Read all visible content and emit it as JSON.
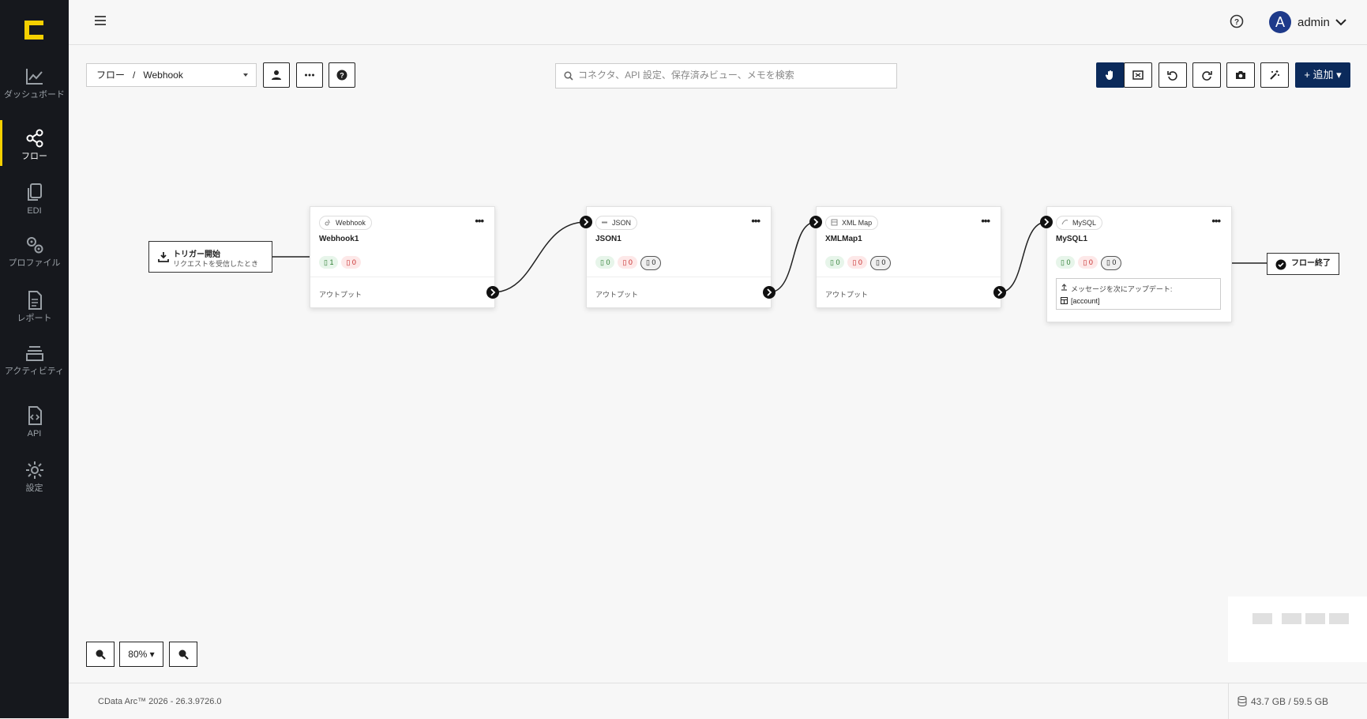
{
  "sidebar": {
    "items": [
      {
        "label": "ダッシュボード",
        "icon": "chart-line-icon"
      },
      {
        "label": "フロー",
        "icon": "share-nodes-icon",
        "active": true
      },
      {
        "label": "EDI",
        "icon": "documents-icon"
      },
      {
        "label": "プロファイル",
        "icon": "gears-icon"
      },
      {
        "label": "レポート",
        "icon": "report-icon"
      },
      {
        "label": "アクティビティ",
        "icon": "layers-icon"
      },
      {
        "label": "API",
        "icon": "api-file-icon"
      },
      {
        "label": "設定",
        "icon": "gear-icon"
      }
    ]
  },
  "header": {
    "avatar_initial": "A",
    "user": "admin"
  },
  "breadcrumb": {
    "root": "フロー",
    "separator": "/",
    "current": "Webhook"
  },
  "search": {
    "placeholder": "コネクタ、API 設定、保存済みビュー、メモを検索"
  },
  "toolbar": {
    "add_label": "+ 追加",
    "colors": {
      "primary": "#0b2a5b",
      "accent": "#f5d000"
    }
  },
  "trigger": {
    "title": "トリガー開始",
    "subtitle": "リクエストを受信したとき"
  },
  "nodes": [
    {
      "type": "Webhook",
      "name": "Webhook1",
      "success": "1",
      "error": "0",
      "output": "アウトプット"
    },
    {
      "type": "JSON",
      "name": "JSON1",
      "success": "0",
      "error": "0",
      "pending": "0",
      "output": "アウトプット"
    },
    {
      "type": "XML Map",
      "name": "XMLMap1",
      "success": "0",
      "error": "0",
      "pending": "0",
      "output": "アウトプット"
    },
    {
      "type": "MySQL",
      "name": "MySQL1",
      "success": "0",
      "error": "0",
      "pending": "0",
      "update_label": "メッセージを次にアップデート:",
      "update_target": "[account]"
    }
  ],
  "flow_end": "フロー終了",
  "zoom": {
    "level": "80%"
  },
  "footer": {
    "version": "CData Arc™ 2026 - 26.3.9726.0",
    "storage": "43.7 GB / 59.5 GB"
  }
}
